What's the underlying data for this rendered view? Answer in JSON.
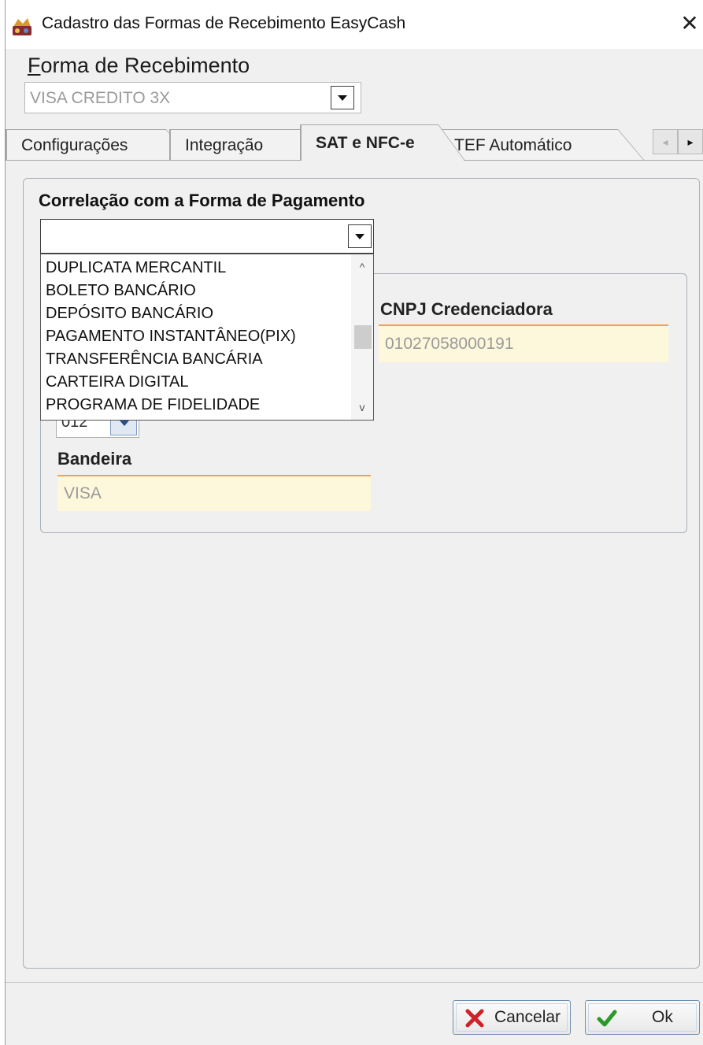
{
  "window": {
    "title": "Cadastro das Formas de Recebimento EasyCash",
    "close_glyph": "✕"
  },
  "forma": {
    "label_first": "F",
    "label_rest": "orma de Recebimento",
    "value": "VISA CREDITO 3X"
  },
  "tabs": [
    {
      "label": "Configurações",
      "active": false
    },
    {
      "label": "Integração",
      "active": false
    },
    {
      "label": "SAT e NFC-e",
      "active": true
    },
    {
      "label": "TEF Automático",
      "active": false
    }
  ],
  "tab_scroll": {
    "left": "◂",
    "right": "▸"
  },
  "correlacao": {
    "label": "Correlação com a Forma de Pagamento",
    "value": "",
    "options": [
      "DUPLICATA MERCANTIL",
      "BOLETO BANCÁRIO",
      "DEPÓSITO BANCÁRIO",
      "PAGAMENTO INSTANTÂNEO(PIX)",
      "TRANSFERÊNCIA BANCÁRIA",
      "CARTEIRA DIGITAL",
      "PROGRAMA DE FIDELIDADE"
    ],
    "scroll_up": "^",
    "scroll_down": "v"
  },
  "cnpj": {
    "label": "CNPJ Credenciadora",
    "value": "01027058000191"
  },
  "codigo": {
    "value": "012"
  },
  "bandeira": {
    "label": "Bandeira",
    "value": "VISA"
  },
  "footer": {
    "cancel_label": "Cancelar",
    "ok_label": "Ok"
  },
  "colors": {
    "cancel_icon": "#d0202a",
    "ok_icon": "#2a9a2a",
    "field_bg": "#fdf8dc",
    "field_accent": "#f0a058"
  }
}
